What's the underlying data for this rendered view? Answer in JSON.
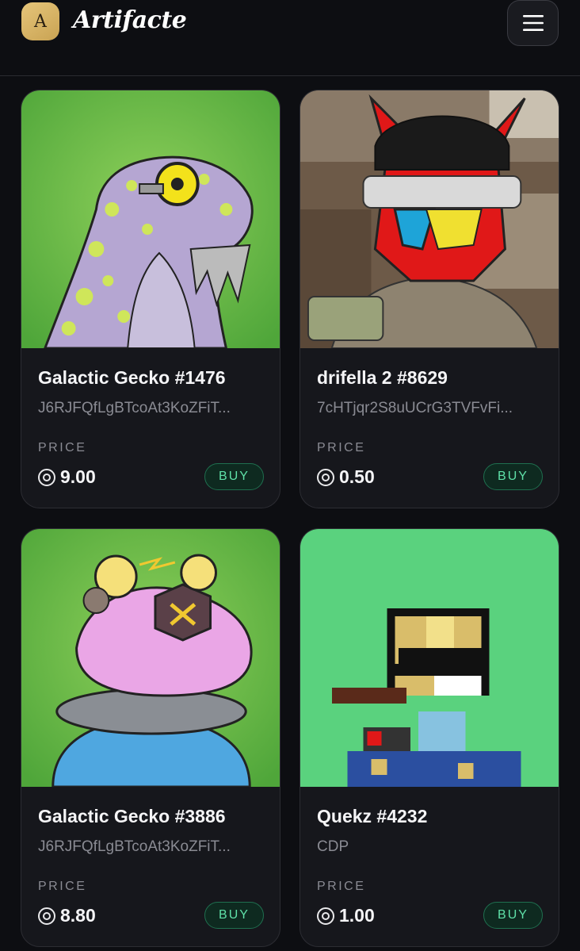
{
  "header": {
    "logo_letter": "A",
    "brand": "Artifacte"
  },
  "price_label": "PRICE",
  "cards": [
    {
      "title": "Galactic Gecko #1476",
      "subtitle": "J6RJFQfLgBTcoAt3KoZFiT...",
      "price": "9.00",
      "buy_label": "BUY",
      "image": "gecko-purple-cyborg"
    },
    {
      "title": "drifella 2 #8629",
      "subtitle": "7cHTjqr2S8uUCrG3TVFvFi...",
      "price": "0.50",
      "buy_label": "BUY",
      "image": "red-creature-beanie"
    },
    {
      "title": "Galactic Gecko #3886",
      "subtitle": "J6RJFQfLgBTcoAt3KoZFiT...",
      "price": "8.80",
      "buy_label": "BUY",
      "image": "gecko-pink-bulbs"
    },
    {
      "title": "Quekz #4232",
      "subtitle": "CDP",
      "price": "1.00",
      "buy_label": "BUY",
      "image": "pixel-duck"
    }
  ]
}
